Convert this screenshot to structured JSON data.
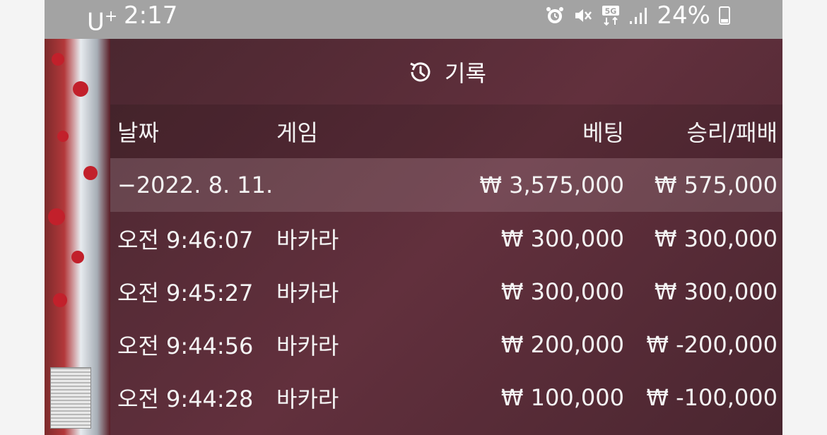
{
  "statusbar": {
    "carrier": "U",
    "carrier_sup": "+",
    "time": "2:17",
    "icons": [
      "alarm-icon",
      "mute-icon",
      "5g-icon",
      "signal-icon"
    ],
    "battery": "24%"
  },
  "panel": {
    "title": "기록",
    "icon": "history-icon",
    "columns": [
      "날짜",
      "게임",
      "베팅",
      "승리/패배"
    ],
    "summary": {
      "date": "−2022. 8. 11.",
      "game": "",
      "bet": "₩ 3,575,000",
      "result": "₩ 575,000"
    },
    "rows": [
      {
        "time": "오전 9:46:07",
        "game": "바카라",
        "bet": "₩ 300,000",
        "result": "₩ 300,000"
      },
      {
        "time": "오전 9:45:27",
        "game": "바카라",
        "bet": "₩ 300,000",
        "result": "₩ 300,000"
      },
      {
        "time": "오전 9:44:56",
        "game": "바카라",
        "bet": "₩ 200,000",
        "result": "₩ -200,000"
      },
      {
        "time": "오전 9:44:28",
        "game": "바카라",
        "bet": "₩ 100,000",
        "result": "₩ -100,000"
      }
    ]
  }
}
